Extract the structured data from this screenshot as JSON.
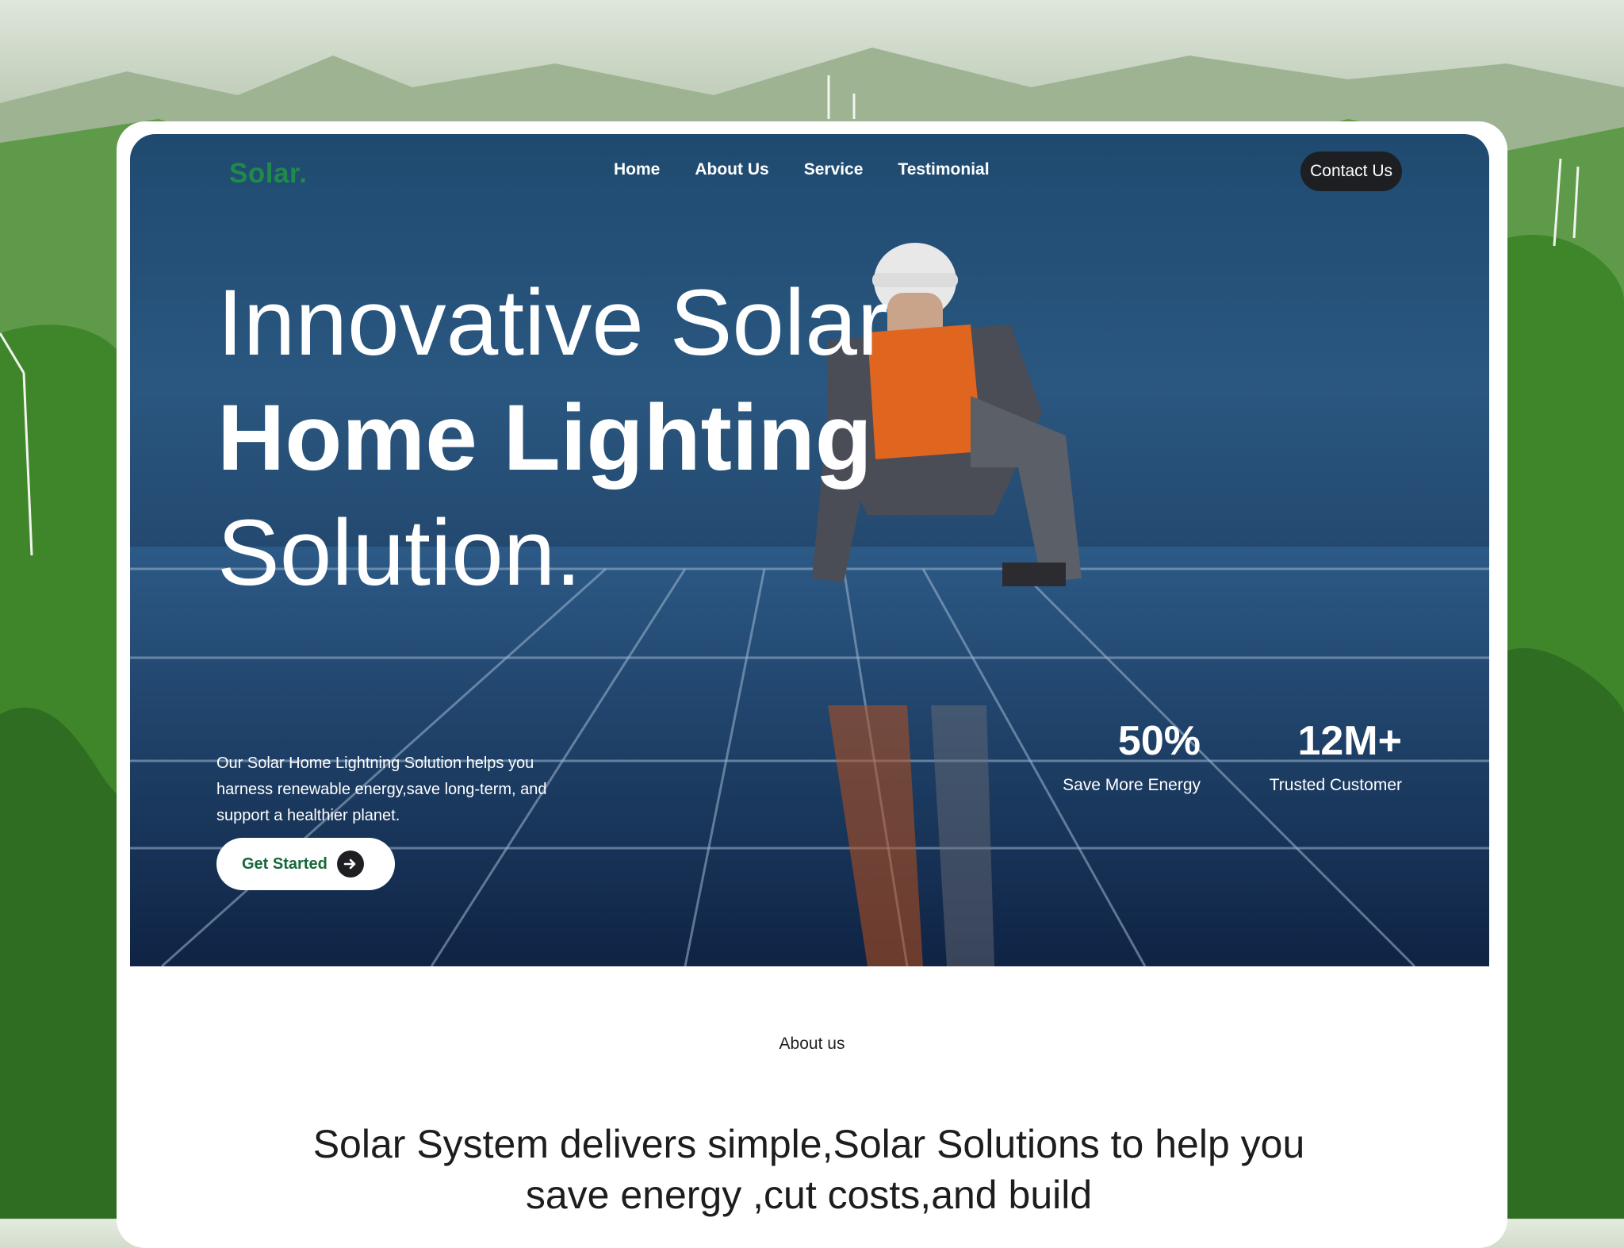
{
  "brand": {
    "logo": "Solar."
  },
  "nav": {
    "items": [
      "Home",
      "About Us",
      "Service",
      "Testimonial"
    ]
  },
  "header": {
    "contact_label": "Contact Us"
  },
  "hero": {
    "headline": {
      "line1": "Innovative Solar",
      "line2": "Home Lighting",
      "line3": "Solution."
    },
    "description": "Our Solar Home Lightning Solution helps you harness renewable energy,save long-term, and support a healthier planet.",
    "cta_label": "Get Started",
    "stats": [
      {
        "value": "50%",
        "label": "Save More Energy"
      },
      {
        "value": "12M+",
        "label": "Trusted Customer"
      }
    ]
  },
  "about": {
    "tag": "About us",
    "text": "Solar System delivers simple,Solar Solutions to help you save energy ,cut costs,and build"
  },
  "colors": {
    "brand_green": "#1f8a4a",
    "cta_text": "#16683a",
    "dark_button": "#1d1f23"
  },
  "icons": {
    "cta": "arrow-right-icon"
  }
}
